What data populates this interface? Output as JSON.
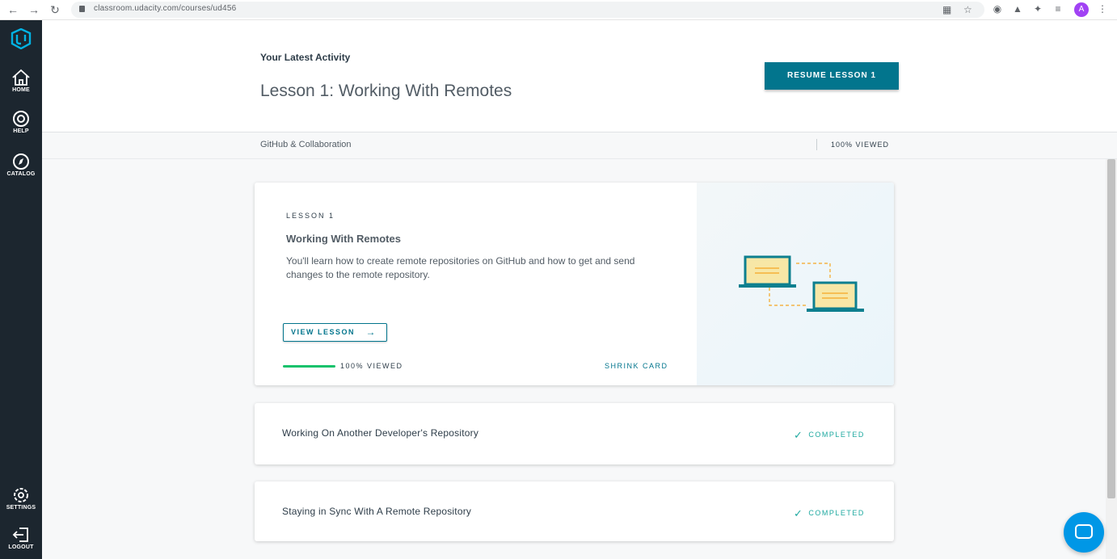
{
  "browser": {
    "url": "classroom.udacity.com/courses/ud456"
  },
  "sidebar": {
    "items": [
      {
        "label": "HOME",
        "icon": "home-icon"
      },
      {
        "label": "HELP",
        "icon": "lifebuoy-icon"
      },
      {
        "label": "CATALOG",
        "icon": "compass-icon"
      },
      {
        "label": "SETTINGS",
        "icon": "gear-icon"
      },
      {
        "label": "LOGOUT",
        "icon": "logout-icon"
      }
    ]
  },
  "header": {
    "latest_label": "Your Latest Activity",
    "lesson_title": "Lesson 1: Working With Remotes",
    "resume_label": "RESUME LESSON 1",
    "course_name": "GitHub & Collaboration",
    "viewed": "100% VIEWED"
  },
  "main_card": {
    "lesson_number": "LESSON 1",
    "title": "Working With Remotes",
    "description": "You'll learn how to create remote repositories on GitHub and how to get and send changes to the remote repository.",
    "view_label": "VIEW LESSON",
    "progress_percent": 100,
    "progress_label": "100% VIEWED",
    "shrink_label": "SHRINK CARD"
  },
  "lessons": [
    {
      "title": "Working On Another Developer's Repository",
      "status": "COMPLETED"
    },
    {
      "title": "Staying in Sync With A Remote Repository",
      "status": "COMPLETED"
    }
  ],
  "colors": {
    "accent": "#02758d",
    "sidebar": "#1c262f",
    "progress": "#15c26b",
    "completed": "#1fa9a0"
  }
}
